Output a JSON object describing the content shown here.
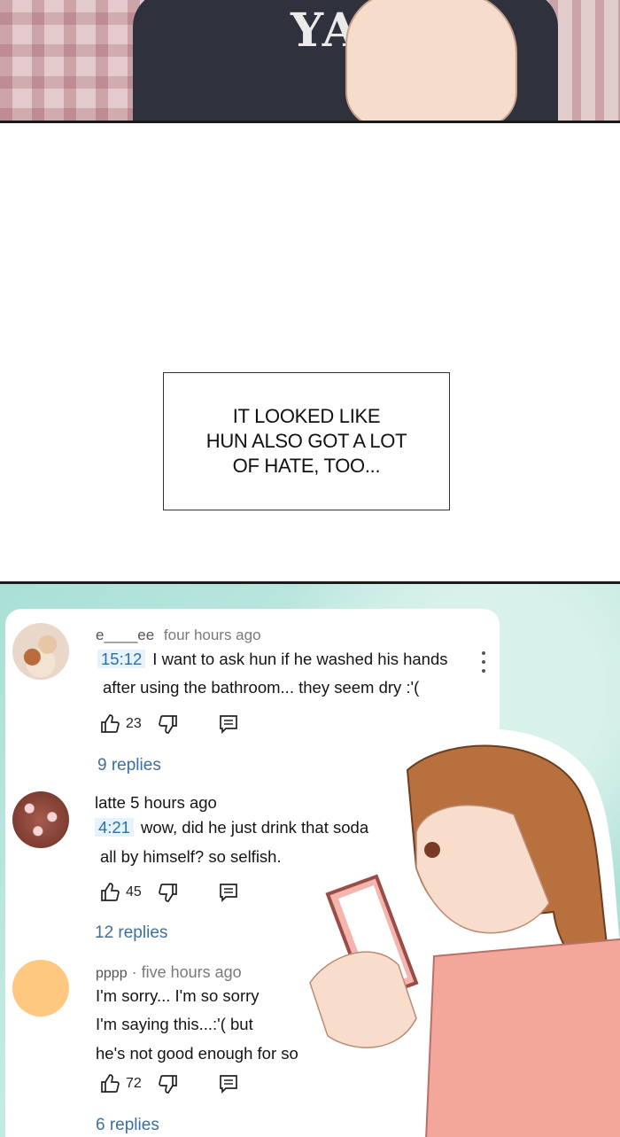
{
  "caption": "IT LOOKED LIKE\nHUN ALSO GOT A LOT\nOF HATE, TOO...",
  "top_panel": {
    "shirt_text": "YA"
  },
  "comments": [
    {
      "user": "e____ee",
      "time": "four hours ago",
      "timestamp": "15:12",
      "line1": "I want to ask hun if he washed his hands",
      "line2": "after using the bathroom... they seem dry :'(",
      "likes": "23",
      "replies": "9 replies",
      "avatar": "cupcake-avatar"
    },
    {
      "user": "latte",
      "time": "5 hours ago",
      "timestamp": "4:21",
      "line1": "wow, did he just drink that soda",
      "line2": "all by himself? so selfish.",
      "likes": "45",
      "replies": "12 replies",
      "avatar": "hearts-avatar"
    },
    {
      "user": "pppp",
      "separator": "·",
      "time": "five hours ago",
      "line1": "I'm sorry... I'm so sorry",
      "line2": "I'm saying this...:'( but",
      "line3": "he's not good enough for so",
      "likes": "72",
      "replies": "6 replies",
      "avatar_color": "#ffc880"
    }
  ],
  "icons": {
    "like": "thumbs-up-icon",
    "dislike": "thumbs-down-icon",
    "reply": "reply-icon",
    "menu": "more-vertical-icon"
  },
  "colors": {
    "background_teal": "#a9e0d6",
    "link_blue": "#3d6f9f",
    "timestamp_bg": "#e6f3fa"
  }
}
